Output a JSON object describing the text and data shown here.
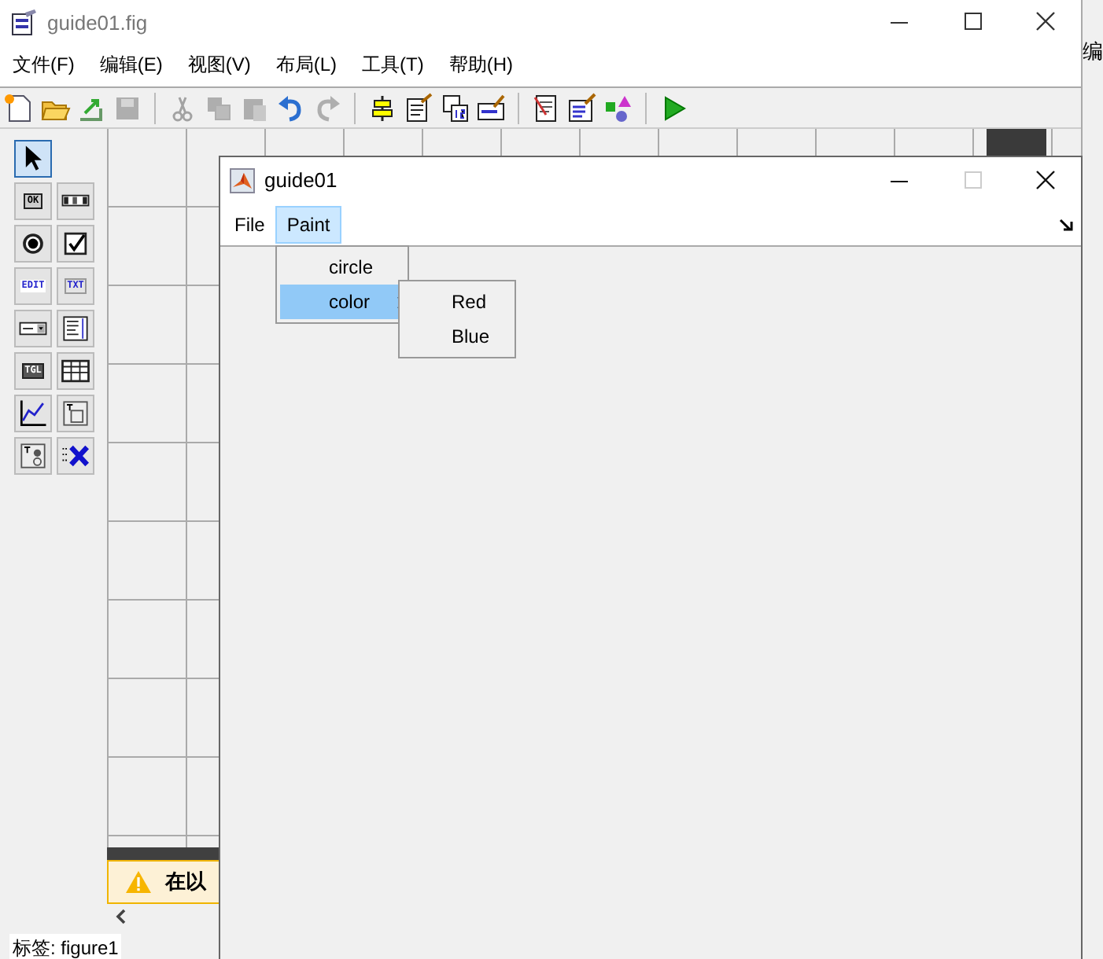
{
  "guide_window": {
    "title": "guide01.fig",
    "menu": [
      "文件(F)",
      "编辑(E)",
      "视图(V)",
      "布局(L)",
      "工具(T)",
      "帮助(H)"
    ],
    "toolbar_groups": [
      [
        {
          "disabled": false
        },
        {
          "disabled": false
        },
        {
          "disabled": false
        },
        {
          "disabled": true
        }
      ],
      [
        {
          "disabled": true
        },
        {
          "disabled": true
        },
        {
          "disabled": true
        },
        {
          "disabled": false
        },
        {
          "disabled": true
        }
      ],
      [
        {
          "disabled": false
        },
        {
          "disabled": false
        },
        {
          "disabled": false
        },
        {
          "disabled": false
        }
      ],
      [
        {
          "disabled": false
        },
        {
          "disabled": false
        },
        {
          "disabled": false
        }
      ],
      [
        {
          "disabled": false
        }
      ]
    ],
    "palette": [
      {
        "kind": "pointer",
        "selected": true
      },
      {
        "kind": "pushbutton",
        "selected": false,
        "label": "OK"
      },
      {
        "kind": "slider",
        "selected": false
      },
      {
        "kind": "radio",
        "selected": false
      },
      {
        "kind": "checkbox",
        "selected": false
      },
      {
        "kind": "edit",
        "selected": false,
        "label": "EDIT"
      },
      {
        "kind": "text",
        "selected": false,
        "label": "TXT"
      },
      {
        "kind": "popup",
        "selected": false
      },
      {
        "kind": "listbox",
        "selected": false
      },
      {
        "kind": "toggle",
        "selected": false,
        "label": "TGL"
      },
      {
        "kind": "table",
        "selected": false
      },
      {
        "kind": "axes",
        "selected": false
      },
      {
        "kind": "panel",
        "selected": false
      },
      {
        "kind": "buttongroup",
        "selected": false
      },
      {
        "kind": "activex",
        "selected": false
      }
    ],
    "warning": "在以",
    "status": "标签: figure1"
  },
  "side_window": {
    "text": "编"
  },
  "figure_window": {
    "title": "guide01",
    "menu": [
      {
        "label": "File",
        "selected": false
      },
      {
        "label": "Paint",
        "selected": true
      }
    ],
    "dropdown": [
      {
        "label": "circle",
        "selected": false
      },
      {
        "label": "color",
        "selected": true,
        "submenu": true
      }
    ],
    "submenu": [
      {
        "label": "Red",
        "selected": false
      },
      {
        "label": "Blue",
        "selected": false
      }
    ]
  }
}
